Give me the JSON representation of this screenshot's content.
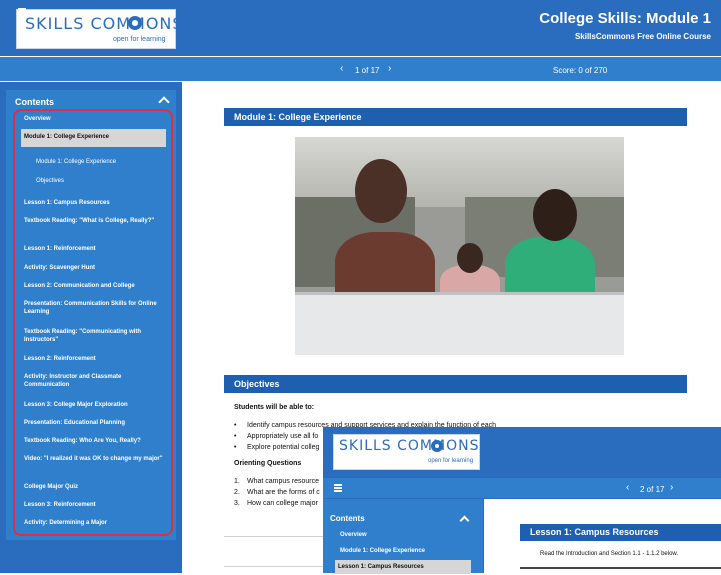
{
  "header": {
    "logo_text": "SKILLS COMMONS",
    "logo_tagline": "open for learning",
    "title": "College Skills: Module 1",
    "subtitle": "SkillsCommons Free Online Course"
  },
  "nav": {
    "page_indicator": "1 of 17",
    "score": "Score: 0 of 270",
    "prev_icon": "chevron-left-icon",
    "next_icon": "chevron-right-icon",
    "menu_icon": "hamburger-icon"
  },
  "sidebar": {
    "heading": "Contents",
    "items": [
      {
        "label": "Overview",
        "type": "item"
      },
      {
        "label": "Module 1: College Experience",
        "type": "active"
      },
      {
        "label": "Module 1: College Experience",
        "type": "sub"
      },
      {
        "label": "Objectives",
        "type": "sub"
      },
      {
        "label": "Lesson 1: Campus Resources",
        "type": "item"
      },
      {
        "label": "Textbook Reading: \"What is College, Really?\"",
        "type": "item"
      },
      {
        "label": "Lesson 1: Reinforcement",
        "type": "item"
      },
      {
        "label": "Activity: Scavenger Hunt",
        "type": "item"
      },
      {
        "label": "Lesson 2: Communication and College",
        "type": "item"
      },
      {
        "label": "Presentation: Communication Skills for Online Learning",
        "type": "item"
      },
      {
        "label": "Textbook Reading: \"Communicating with Instructors\"",
        "type": "item"
      },
      {
        "label": "Lesson 2: Reinforcement",
        "type": "item"
      },
      {
        "label": "Activity: Instructor and Classmate Communication",
        "type": "item"
      },
      {
        "label": "Lesson 3: College Major Exploration",
        "type": "item"
      },
      {
        "label": "Presentation: Educational Planning",
        "type": "item"
      },
      {
        "label": "Textbook Reading: Who Are You, Really?",
        "type": "item"
      },
      {
        "label": "Video: \"I realized it was OK to change my major\"",
        "type": "item"
      },
      {
        "label": "College Major Quiz",
        "type": "item"
      },
      {
        "label": "Lesson 3: Reinforcement",
        "type": "item"
      },
      {
        "label": "Activity: Determining a Major",
        "type": "item"
      }
    ]
  },
  "main": {
    "section_title": "Module 1: College Experience",
    "objectives_title": "Objectives",
    "students_heading": "Students will be able to:",
    "bullets": [
      "Identify campus resources and support services and explain the function of each",
      "Appropriately use all fo",
      "Explore potential colleg"
    ],
    "orienting_heading": "Orienting Questions",
    "questions": [
      "What campus resource",
      "What are the forms of c",
      "How can college major"
    ]
  },
  "overlay": {
    "logo_text": "SKILLS COMMONS",
    "logo_tagline": "open for learning",
    "page_indicator": "2 of 17",
    "sidebar_heading": "Contents",
    "sidebar_items": [
      "Overview",
      "Module 1: College Experience",
      "Lesson 1: Campus Resources"
    ],
    "section_title": "Lesson 1: Campus Resources",
    "intro_text": "Read the Introduction and Section 1.1 - 1.1.2 below."
  }
}
